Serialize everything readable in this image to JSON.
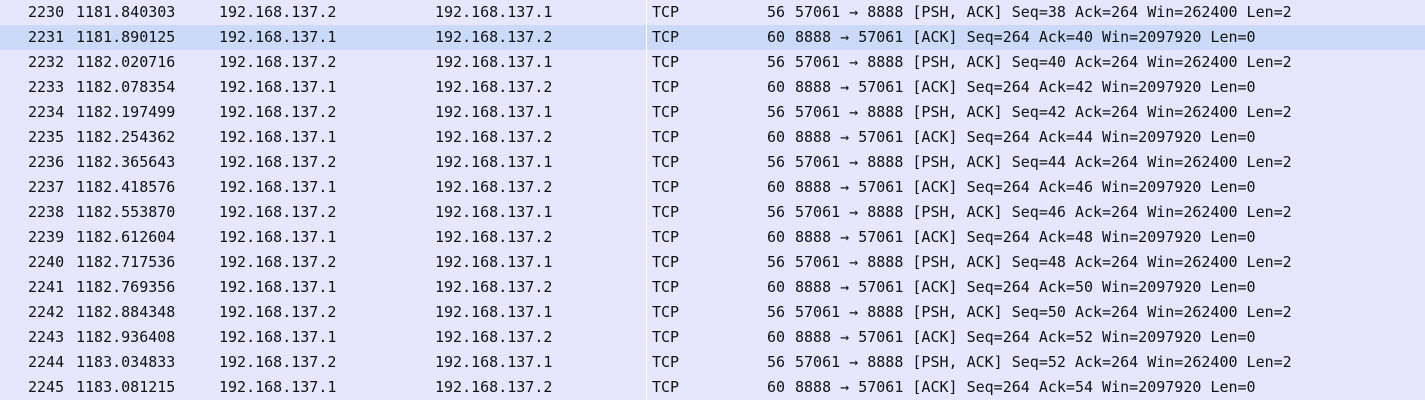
{
  "packets": [
    {
      "no": "2230",
      "time": "1181.840303",
      "source": "192.168.137.2",
      "destination": "192.168.137.1",
      "protocol": "TCP",
      "length": "56",
      "info": "57061 → 8888 [PSH, ACK] Seq=38 Ack=264 Win=262400 Len=2"
    },
    {
      "no": "2231",
      "time": "1181.890125",
      "source": "192.168.137.1",
      "destination": "192.168.137.2",
      "protocol": "TCP",
      "length": "60",
      "info": "8888 → 57061 [ACK] Seq=264 Ack=40 Win=2097920 Len=0"
    },
    {
      "no": "2232",
      "time": "1182.020716",
      "source": "192.168.137.2",
      "destination": "192.168.137.1",
      "protocol": "TCP",
      "length": "56",
      "info": "57061 → 8888 [PSH, ACK] Seq=40 Ack=264 Win=262400 Len=2"
    },
    {
      "no": "2233",
      "time": "1182.078354",
      "source": "192.168.137.1",
      "destination": "192.168.137.2",
      "protocol": "TCP",
      "length": "60",
      "info": "8888 → 57061 [ACK] Seq=264 Ack=42 Win=2097920 Len=0"
    },
    {
      "no": "2234",
      "time": "1182.197499",
      "source": "192.168.137.2",
      "destination": "192.168.137.1",
      "protocol": "TCP",
      "length": "56",
      "info": "57061 → 8888 [PSH, ACK] Seq=42 Ack=264 Win=262400 Len=2"
    },
    {
      "no": "2235",
      "time": "1182.254362",
      "source": "192.168.137.1",
      "destination": "192.168.137.2",
      "protocol": "TCP",
      "length": "60",
      "info": "8888 → 57061 [ACK] Seq=264 Ack=44 Win=2097920 Len=0"
    },
    {
      "no": "2236",
      "time": "1182.365643",
      "source": "192.168.137.2",
      "destination": "192.168.137.1",
      "protocol": "TCP",
      "length": "56",
      "info": "57061 → 8888 [PSH, ACK] Seq=44 Ack=264 Win=262400 Len=2"
    },
    {
      "no": "2237",
      "time": "1182.418576",
      "source": "192.168.137.1",
      "destination": "192.168.137.2",
      "protocol": "TCP",
      "length": "60",
      "info": "8888 → 57061 [ACK] Seq=264 Ack=46 Win=2097920 Len=0"
    },
    {
      "no": "2238",
      "time": "1182.553870",
      "source": "192.168.137.2",
      "destination": "192.168.137.1",
      "protocol": "TCP",
      "length": "56",
      "info": "57061 → 8888 [PSH, ACK] Seq=46 Ack=264 Win=262400 Len=2"
    },
    {
      "no": "2239",
      "time": "1182.612604",
      "source": "192.168.137.1",
      "destination": "192.168.137.2",
      "protocol": "TCP",
      "length": "60",
      "info": "8888 → 57061 [ACK] Seq=264 Ack=48 Win=2097920 Len=0"
    },
    {
      "no": "2240",
      "time": "1182.717536",
      "source": "192.168.137.2",
      "destination": "192.168.137.1",
      "protocol": "TCP",
      "length": "56",
      "info": "57061 → 8888 [PSH, ACK] Seq=48 Ack=264 Win=262400 Len=2"
    },
    {
      "no": "2241",
      "time": "1182.769356",
      "source": "192.168.137.1",
      "destination": "192.168.137.2",
      "protocol": "TCP",
      "length": "60",
      "info": "8888 → 57061 [ACK] Seq=264 Ack=50 Win=2097920 Len=0"
    },
    {
      "no": "2242",
      "time": "1182.884348",
      "source": "192.168.137.2",
      "destination": "192.168.137.1",
      "protocol": "TCP",
      "length": "56",
      "info": "57061 → 8888 [PSH, ACK] Seq=50 Ack=264 Win=262400 Len=2"
    },
    {
      "no": "2243",
      "time": "1182.936408",
      "source": "192.168.137.1",
      "destination": "192.168.137.2",
      "protocol": "TCP",
      "length": "60",
      "info": "8888 → 57061 [ACK] Seq=264 Ack=52 Win=2097920 Len=0"
    },
    {
      "no": "2244",
      "time": "1183.034833",
      "source": "192.168.137.2",
      "destination": "192.168.137.1",
      "protocol": "TCP",
      "length": "56",
      "info": "57061 → 8888 [PSH, ACK] Seq=52 Ack=264 Win=262400 Len=2"
    },
    {
      "no": "2245",
      "time": "1183.081215",
      "source": "192.168.137.1",
      "destination": "192.168.137.2",
      "protocol": "TCP",
      "length": "60",
      "info": "8888 → 57061 [ACK] Seq=264 Ack=54 Win=2097920 Len=0"
    }
  ],
  "selected_row": "2231",
  "colors": {
    "row_background": "#e7e6ff",
    "selected_background": "#cbdaf8",
    "text": "#111111"
  }
}
